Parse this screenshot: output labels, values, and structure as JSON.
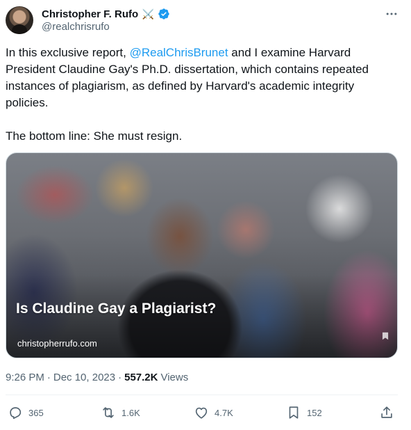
{
  "author": {
    "display_name": "Christopher F. Rufo",
    "handle": "@realchrisrufo",
    "emoji": "⚔️"
  },
  "tweet": {
    "text_before_mention": "In this exclusive report, ",
    "mention": "@RealChrisBrunet",
    "text_after_mention": " and I examine Harvard President Claudine Gay's Ph.D. dissertation, which contains repeated instances of plagiarism, as defined by Harvard's academic integrity policies.",
    "paragraph_2": "The bottom line: She must resign."
  },
  "card": {
    "title": "Is Claudine Gay a Plagiarist?",
    "domain": "christopherrufo.com"
  },
  "meta": {
    "time": "9:26 PM",
    "separator": "·",
    "date": "Dec 10, 2023",
    "views_count": "557.2K",
    "views_label": "Views"
  },
  "actions": {
    "replies": "365",
    "reposts": "1.6K",
    "likes": "4.7K",
    "bookmarks": "152"
  },
  "colors": {
    "accent": "#1d9bf0",
    "text": "#0f1419",
    "muted": "#536471"
  }
}
